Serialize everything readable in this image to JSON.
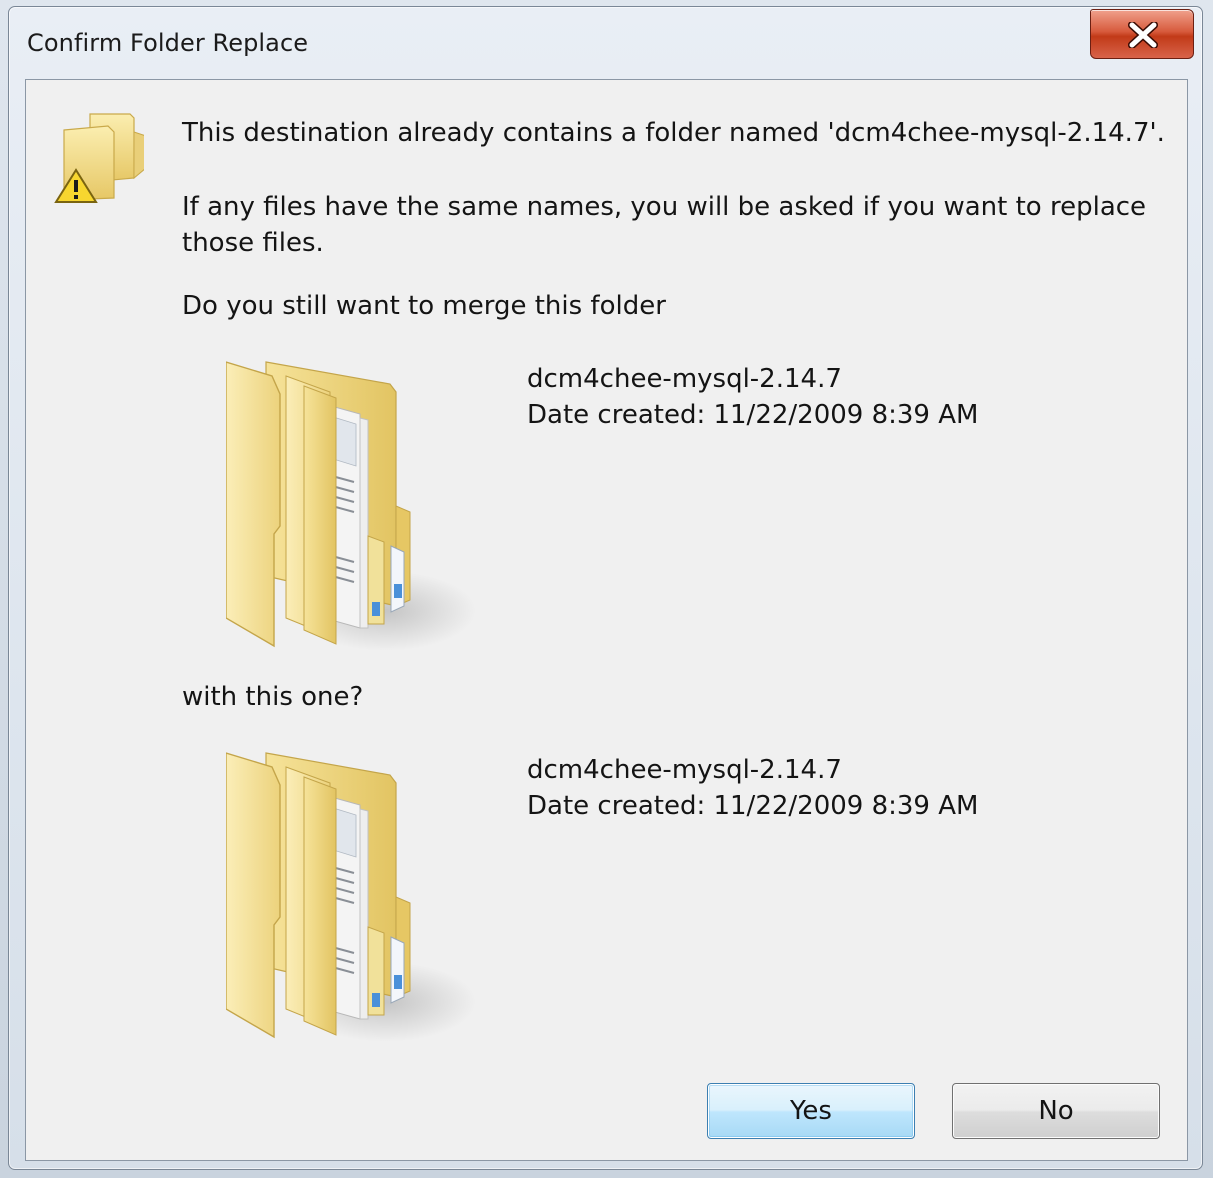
{
  "dialog": {
    "title": "Confirm Folder Replace",
    "message_line1": "This destination already contains a folder named 'dcm4chee-mysql-2.14.7'.",
    "message_line2a": "If any files have the same names, you will be asked if you want to replace",
    "message_line2b": "those files.",
    "question": "Do you still want to merge this folder",
    "with_this_one": "with this one?"
  },
  "existing_folder": {
    "name": "dcm4chee-mysql-2.14.7",
    "date_created": "Date created: 11/22/2009 8:39 AM",
    "icon": "open-folder-icon"
  },
  "new_folder": {
    "name": "dcm4chee-mysql-2.14.7",
    "date_created": "Date created: 11/22/2009 8:39 AM",
    "icon": "open-folder-icon"
  },
  "buttons": {
    "yes": "Yes",
    "no": "No"
  },
  "icons": {
    "header": "folder-warning-icon",
    "close": "close-icon"
  },
  "colors": {
    "close_button": "#c23a18",
    "default_button_border": "#3c7fb1",
    "client_background": "#f0f0f0"
  }
}
